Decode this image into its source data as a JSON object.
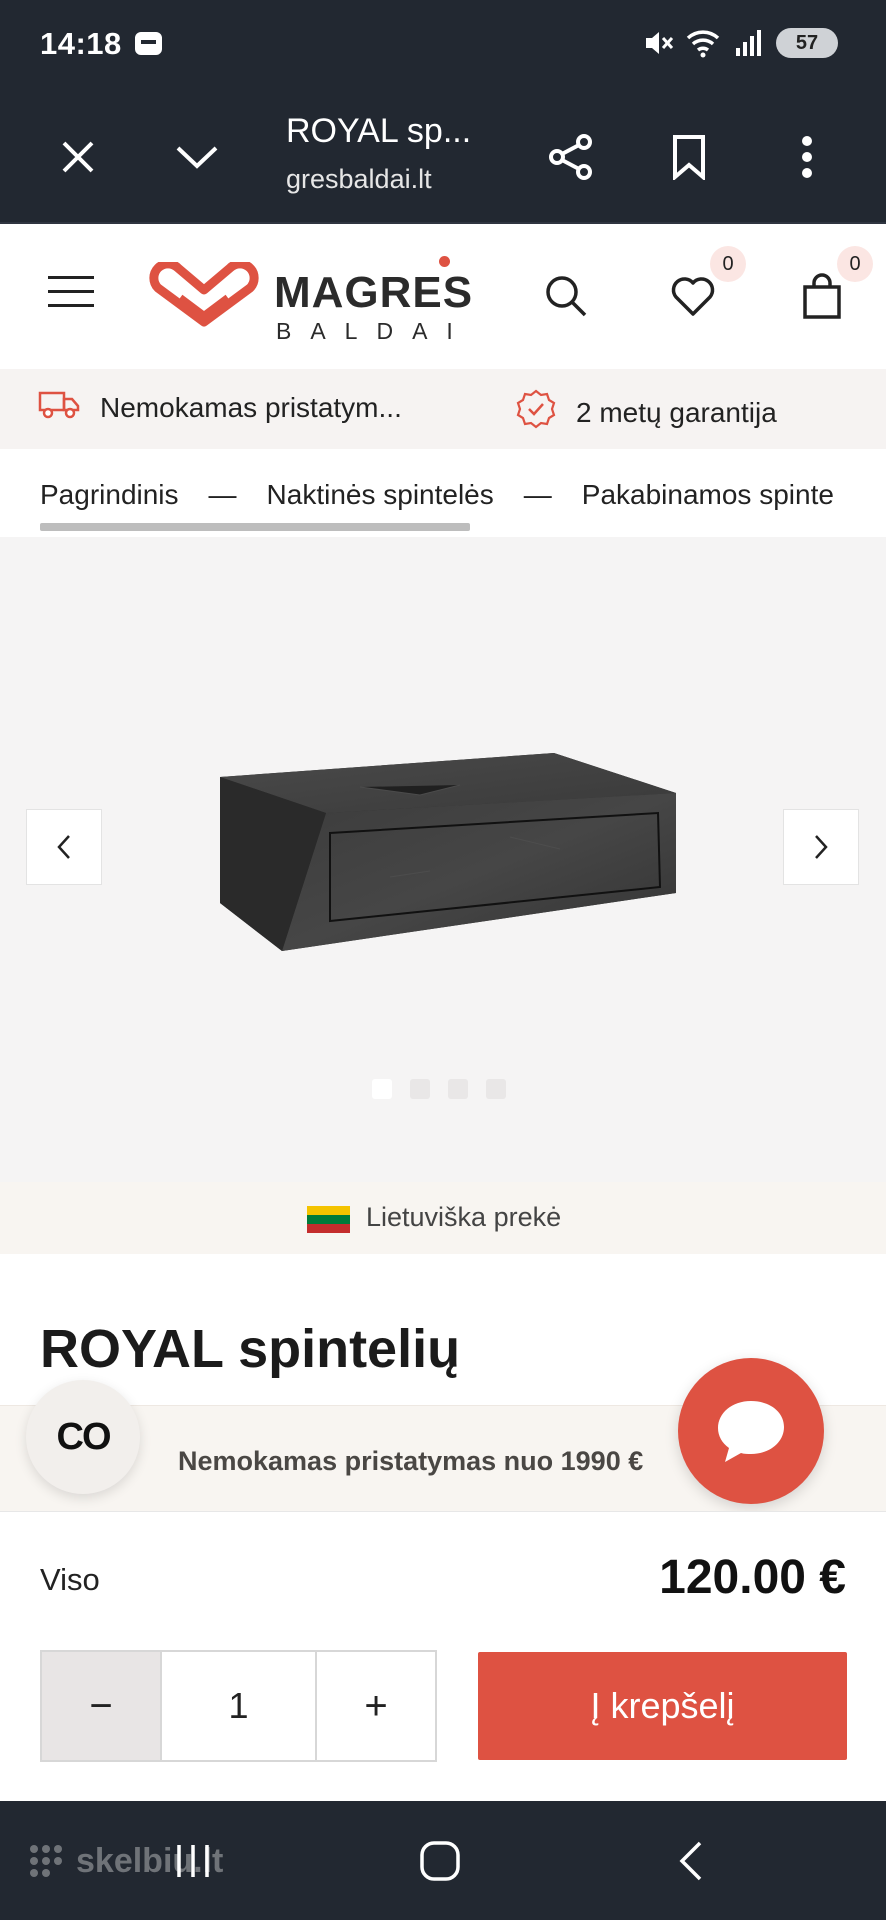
{
  "status_bar": {
    "time": "14:18",
    "battery": "57"
  },
  "browser": {
    "title": "ROYAL sp...",
    "url": "gresbaldai.lt"
  },
  "header": {
    "logo_main": "MAGRES",
    "logo_sub": "BALDAI",
    "wishlist_count": "0",
    "cart_count": "0",
    "accent_color": "#de5242"
  },
  "info_strip": {
    "delivery": "Nemokamas pristatym...",
    "warranty": "2 metų garantija"
  },
  "breadcrumb": {
    "items": [
      "Pagrindinis",
      "Naktinės spintelės",
      "Pakabinamos spinte"
    ],
    "separator": "—"
  },
  "gallery": {
    "slides": 4,
    "active_slide": 1,
    "origin_label": "Lietuviška prekė"
  },
  "product": {
    "title": "ROYAL spintelių"
  },
  "promo": {
    "text": "Nemokamas pristatymas nuo 1990 €",
    "badge": "CO"
  },
  "buy": {
    "total_label": "Viso",
    "price": "120.00 €",
    "quantity": "1",
    "minus": "−",
    "plus": "+",
    "add_to_cart": "Į krepšelį"
  },
  "watermark": "skelbiu.lt"
}
